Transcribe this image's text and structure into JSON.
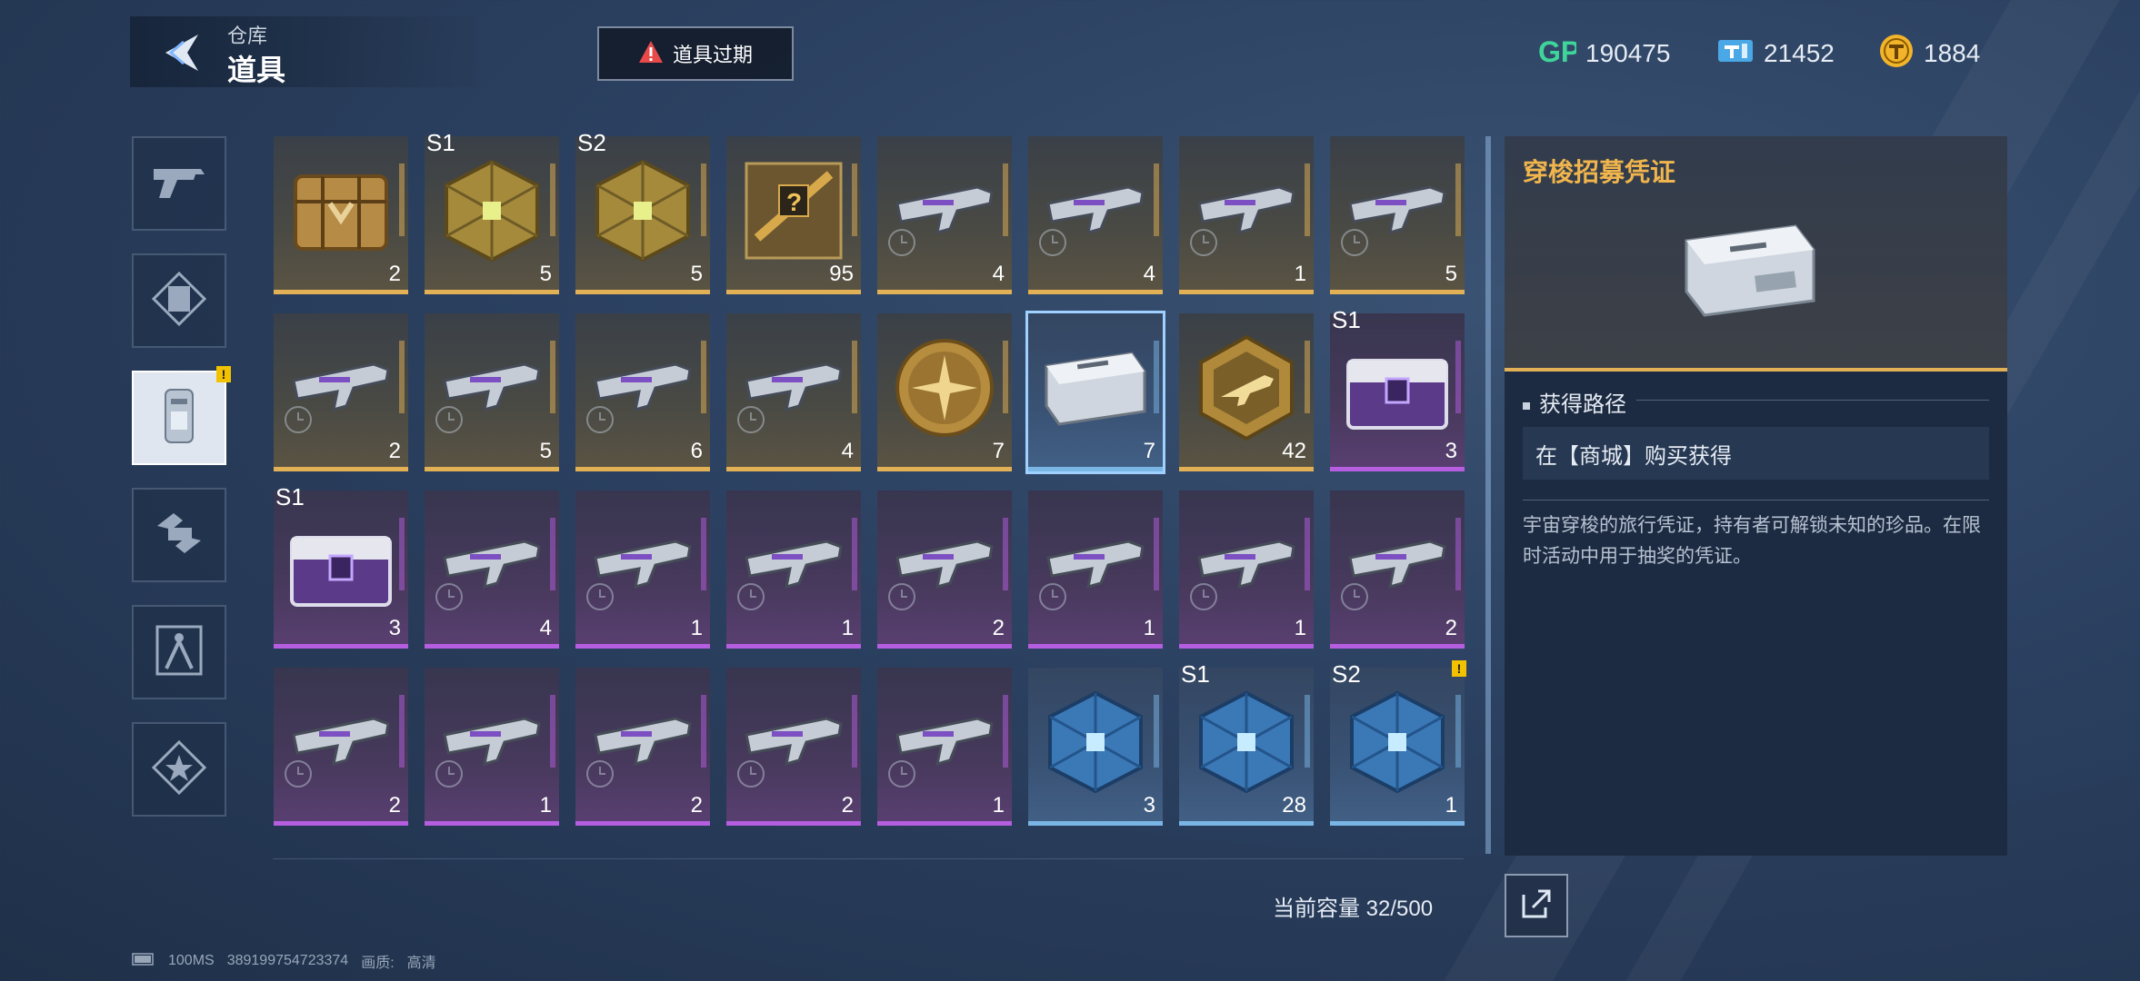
{
  "header": {
    "subtitle": "仓库",
    "title": "道具"
  },
  "expire_button": {
    "label": "道具过期"
  },
  "currencies": [
    {
      "icon": "gp-icon",
      "value": "190475"
    },
    {
      "icon": "ticket-icon",
      "value": "21452"
    },
    {
      "icon": "coin-icon",
      "value": "1884"
    }
  ],
  "sidebar": {
    "tabs": [
      {
        "icon": "gun-icon",
        "active": false
      },
      {
        "icon": "frame-icon",
        "active": false
      },
      {
        "icon": "item-ticket-icon",
        "active": true,
        "badge": "!"
      },
      {
        "icon": "hands-icon",
        "active": false
      },
      {
        "icon": "compass-icon",
        "active": false
      },
      {
        "icon": "star-icon",
        "active": false
      }
    ]
  },
  "grid": {
    "items": [
      {
        "count": "2",
        "season": "",
        "rarity": "gold",
        "kind": "crate"
      },
      {
        "count": "5",
        "season": "S1",
        "rarity": "gold",
        "kind": "cube"
      },
      {
        "count": "5",
        "season": "S2",
        "rarity": "gold",
        "kind": "cube"
      },
      {
        "count": "95",
        "season": "",
        "rarity": "gold",
        "kind": "mystery"
      },
      {
        "count": "4",
        "season": "",
        "rarity": "gold",
        "kind": "gun"
      },
      {
        "count": "4",
        "season": "",
        "rarity": "gold",
        "kind": "gun"
      },
      {
        "count": "1",
        "season": "",
        "rarity": "gold",
        "kind": "gun"
      },
      {
        "count": "5",
        "season": "",
        "rarity": "gold",
        "kind": "gun"
      },
      {
        "count": "2",
        "season": "",
        "rarity": "gold",
        "kind": "gun"
      },
      {
        "count": "5",
        "season": "",
        "rarity": "gold",
        "kind": "gun"
      },
      {
        "count": "6",
        "season": "",
        "rarity": "gold",
        "kind": "gun"
      },
      {
        "count": "4",
        "season": "",
        "rarity": "gold",
        "kind": "gun"
      },
      {
        "count": "7",
        "season": "",
        "rarity": "gold",
        "kind": "medal"
      },
      {
        "count": "7",
        "season": "",
        "rarity": "blue",
        "kind": "voucher",
        "selected": true
      },
      {
        "count": "42",
        "season": "",
        "rarity": "gold",
        "kind": "hexbadge"
      },
      {
        "count": "3",
        "season": "S1",
        "rarity": "purple",
        "kind": "chest"
      },
      {
        "count": "3",
        "season": "S1",
        "rarity": "purple",
        "kind": "chest"
      },
      {
        "count": "4",
        "season": "",
        "rarity": "purple",
        "kind": "gun"
      },
      {
        "count": "1",
        "season": "",
        "rarity": "purple",
        "kind": "gun"
      },
      {
        "count": "1",
        "season": "",
        "rarity": "purple",
        "kind": "gun"
      },
      {
        "count": "2",
        "season": "",
        "rarity": "purple",
        "kind": "gun"
      },
      {
        "count": "1",
        "season": "",
        "rarity": "purple",
        "kind": "gun"
      },
      {
        "count": "1",
        "season": "",
        "rarity": "purple",
        "kind": "gun"
      },
      {
        "count": "2",
        "season": "",
        "rarity": "purple",
        "kind": "gun"
      },
      {
        "count": "2",
        "season": "",
        "rarity": "purple",
        "kind": "gun"
      },
      {
        "count": "1",
        "season": "",
        "rarity": "purple",
        "kind": "gun"
      },
      {
        "count": "2",
        "season": "",
        "rarity": "purple",
        "kind": "gun"
      },
      {
        "count": "2",
        "season": "",
        "rarity": "purple",
        "kind": "gun"
      },
      {
        "count": "1",
        "season": "",
        "rarity": "purple",
        "kind": "gun"
      },
      {
        "count": "3",
        "season": "",
        "rarity": "blue",
        "kind": "bluecube"
      },
      {
        "count": "28",
        "season": "S1",
        "rarity": "blue",
        "kind": "bluecube"
      },
      {
        "count": "1",
        "season": "S2",
        "rarity": "blue",
        "kind": "bluecube",
        "badge": "!"
      }
    ]
  },
  "capacity": {
    "label": "当前容量 32/500"
  },
  "detail": {
    "title": "穿梭招募凭证",
    "section_title": "获得路径",
    "source": "在【商城】购买获得",
    "description": "宇宙穿梭的旅行凭证，持有者可解锁未知的珍品。在限时活动中用于抽奖的凭证。"
  },
  "footer": {
    "latency": "100MS",
    "id": "389199754723374",
    "quality_label": "画质:",
    "quality_value": "高清"
  },
  "colors": {
    "gold": "#e3b155",
    "purple": "#b55ee0",
    "blue": "#79b6e6",
    "title_orange": "#f0b54d",
    "gp_green": "#3fd59a",
    "ticket_blue": "#4aa8e6",
    "coin_gold": "#f2b42a"
  }
}
